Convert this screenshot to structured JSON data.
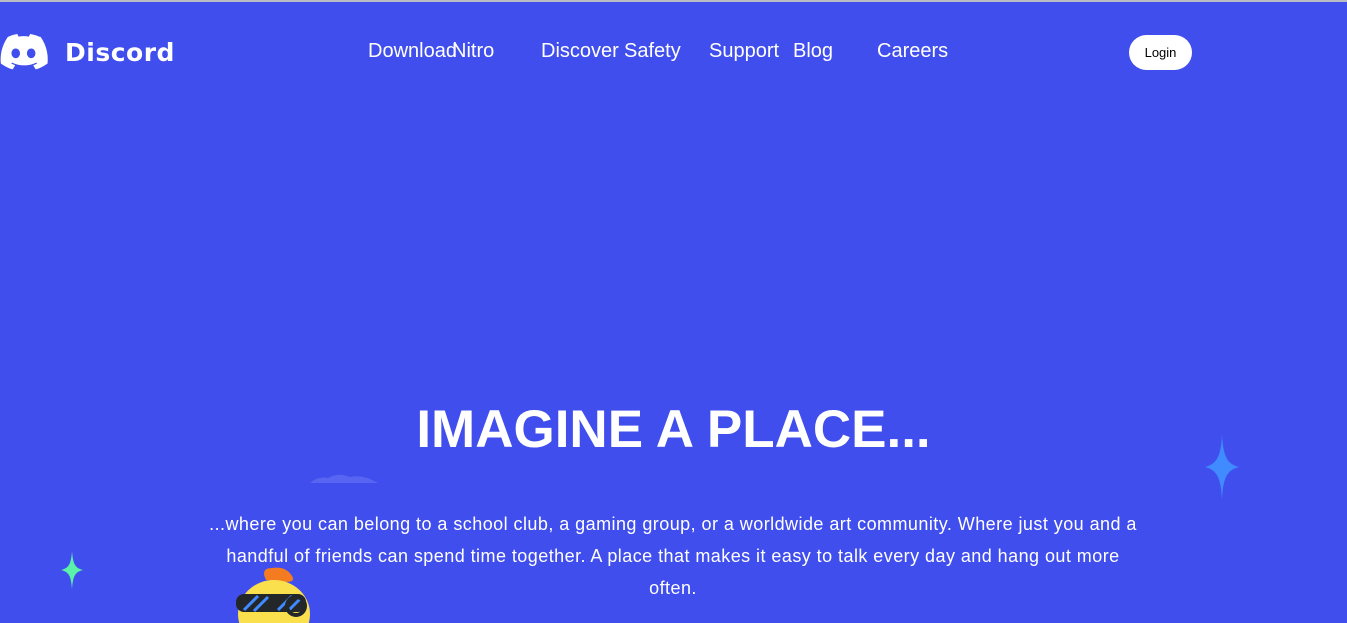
{
  "header": {
    "logo_text": "Discord",
    "logo_icon": "discord-logo-icon",
    "nav": {
      "download": "Download",
      "nitro": "Nitro",
      "discover": "Discover",
      "safety": "Safety",
      "support": "Support",
      "blog": "Blog",
      "careers": "Careers"
    },
    "login_label": "Login"
  },
  "hero": {
    "title": "IMAGINE A PLACE...",
    "description": "...where you can belong to a school club, a gaming group, or a worldwide art community. Where just you and a handful of friends can spend time together. A place that makes it easy to talk every day and hang out more often."
  },
  "decorations": {
    "sparkle_icon": "sparkle-icon",
    "cloud_icon": "cloud-icon",
    "character_icon": "sunglasses-character-icon"
  },
  "colors": {
    "background": "#404eed",
    "text": "#ffffff",
    "login_bg": "#ffffff",
    "sparkle_blue": "#3f8bff",
    "sparkle_green": "#59f2a8",
    "character_yellow": "#fbe04d",
    "character_orange": "#f47b20"
  }
}
